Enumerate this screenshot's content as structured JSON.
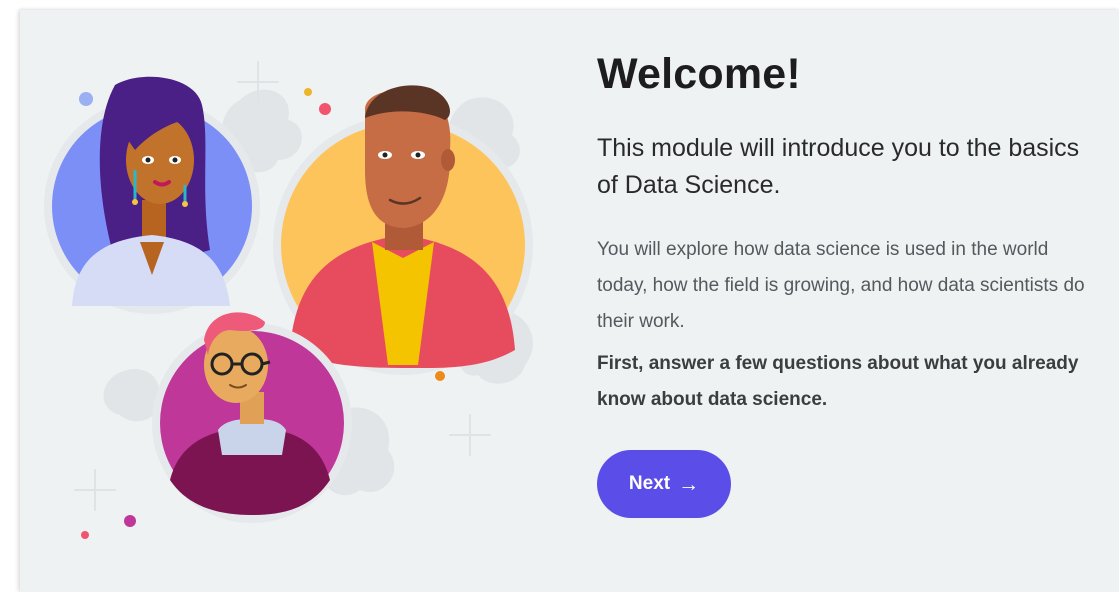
{
  "welcome": {
    "title": "Welcome!",
    "subtitle": "This module will introduce you to the basics of Data Science.",
    "body": "You will explore how data science is used in the world today, how the field is growing, and how data scientists do their work.",
    "emphasis": "First, answer a few questions about what you already know about data science.",
    "next_label": "Next",
    "next_icon": "arrow-right-icon",
    "next_icon_glyph": "→"
  },
  "colors": {
    "page_background": "#eff2f3",
    "accent_button": "#5b4ee8",
    "title_text": "#1d1d1f",
    "body_text": "#55585d",
    "avatar_blue": "#7b8ff7",
    "avatar_yellow": "#fdc45c",
    "avatar_magenta": "#c0379a"
  },
  "illustration": {
    "icons": [
      "woman-avatar-icon",
      "man-avatar-icon",
      "person-with-glasses-avatar-icon"
    ]
  }
}
